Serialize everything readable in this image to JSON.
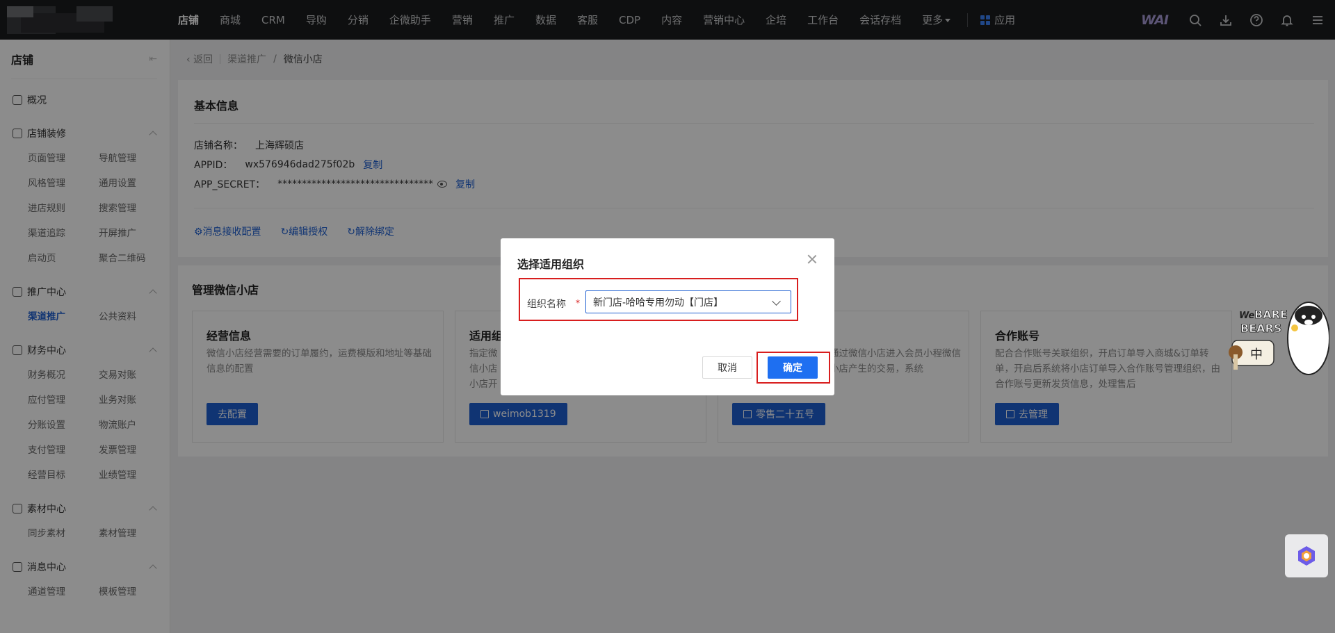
{
  "topbar": {
    "nav": [
      "店铺",
      "商城",
      "CRM",
      "导购",
      "分销",
      "企微助手",
      "营销",
      "推广",
      "数据",
      "客服",
      "CDP",
      "内容",
      "营销中心",
      "企培",
      "工作台",
      "会话存档"
    ],
    "more_label": "更多",
    "apps_label": "应用",
    "brand": "WAI",
    "icons": [
      "search-icon",
      "download-icon",
      "help-icon",
      "bell-icon",
      "menu-icon"
    ]
  },
  "sidebar": {
    "title": "店铺",
    "overview": "概况",
    "groups": [
      {
        "label": "店铺装修",
        "icon": "shop-icon",
        "items": [
          "页面管理",
          "导航管理",
          "风格管理",
          "通用设置",
          "进店规则",
          "搜索管理",
          "渠道追踪",
          "开屏推广",
          "启动页",
          "聚合二维码"
        ]
      },
      {
        "label": "推广中心",
        "icon": "clock-icon",
        "items": [
          "渠道推广",
          "公共资料"
        ]
      },
      {
        "label": "财务中心",
        "icon": "finance-icon",
        "items": [
          "财务概况",
          "交易对账",
          "应付管理",
          "业务对账",
          "分账设置",
          "物流账户",
          "支付管理",
          "发票管理",
          "经营目标",
          "业绩管理"
        ]
      },
      {
        "label": "素材中心",
        "icon": "image-icon",
        "items": [
          "同步素材",
          "素材管理"
        ]
      },
      {
        "label": "消息中心",
        "icon": "bell-icon",
        "items": [
          "通道管理",
          "模板管理"
        ]
      }
    ],
    "active_item": "渠道推广"
  },
  "breadcrumb": {
    "back": "返回",
    "parent": "渠道推广",
    "separator": "/",
    "current": "微信小店"
  },
  "basic_info": {
    "title": "基本信息",
    "store_name_label": "店铺名称：",
    "store_name": "上海辉硕店",
    "appid_label": "APPID：",
    "appid": "wx576946dad275f02b",
    "copy": "复制",
    "secret_label": "APP_SECRET：",
    "secret": "********************************",
    "actions": [
      "消息接收配置",
      "编辑授权",
      "解除绑定"
    ]
  },
  "manage": {
    "title": "管理微信小店",
    "cards": [
      {
        "title": "经营信息",
        "desc": "微信小店经营需要的订单履约，运费模版和地址等基础信息的配置",
        "button": "去配置"
      },
      {
        "title": "适用组",
        "desc": "指定微信小店小店开",
        "button": "weimob1319"
      },
      {
        "title": "",
        "desc": "通过微信小店进入会员小程微信小店产生的交易，系统",
        "button": "零售二十五号"
      },
      {
        "title": "合作账号",
        "desc": "配合合作账号关联组织，开启订单导入商城&订单转单，开启后系统将小店订单导入合作账号管理组织，由合作账号更新发货信息，处理售后",
        "button": "去管理"
      }
    ]
  },
  "modal": {
    "title": "选择适用组织",
    "field_label": "组织名称",
    "required_mark": "*",
    "selected_value": "新门店-哈哈专用勿动【门店】",
    "cancel": "取消",
    "confirm": "确定"
  },
  "sticker": {
    "line1": "We",
    "line2": "BARE",
    "line3": "BEARS",
    "badge": "中"
  },
  "colors": {
    "primary": "#1e5fd1",
    "confirm": "#1e6ff1",
    "highlight": "#d81e1e",
    "topbar": "#1b1c1e"
  }
}
